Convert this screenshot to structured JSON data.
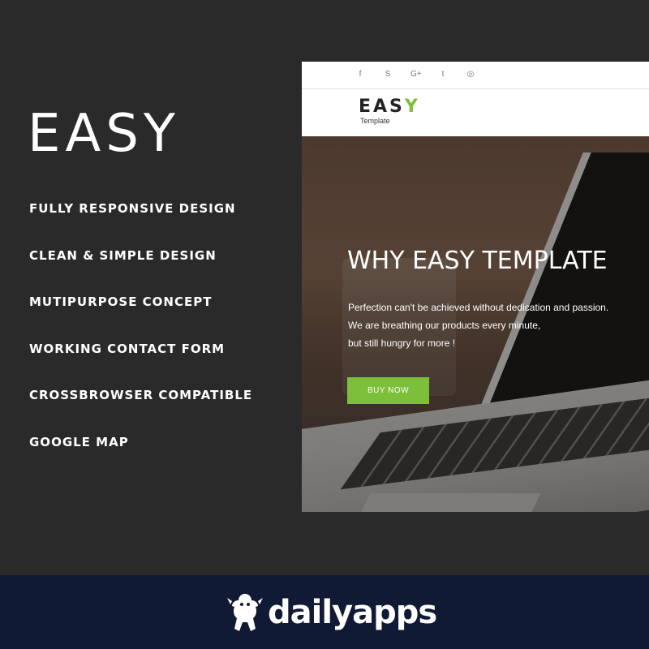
{
  "left": {
    "title": "EASY",
    "features": [
      "FULLY RESPONSIVE DESIGN",
      "CLEAN & SIMPLE DESIGN",
      "MUTIPURPOSE CONCEPT",
      "WORKING CONTACT FORM",
      "CROSSBROWSER COMPATIBLE",
      "GOOGLE MAP"
    ]
  },
  "preview": {
    "social_icons": [
      {
        "name": "facebook-icon",
        "glyph": "f"
      },
      {
        "name": "skype-icon",
        "glyph": "S"
      },
      {
        "name": "google-plus-icon",
        "glyph": "G+"
      },
      {
        "name": "twitter-icon",
        "glyph": "t"
      },
      {
        "name": "dribbble-icon",
        "glyph": "◎"
      }
    ],
    "logo": {
      "word_start": "EAS",
      "word_accent": "Y",
      "subtitle": "Template"
    },
    "hero": {
      "title": "WHY EASY TEMPLATE",
      "lines": [
        "Perfection can't be achieved without dedication and passion.",
        "We are breathing our products every minute,",
        "but still hungry for more !"
      ],
      "button_label": "BUY NOW"
    },
    "accent_color": "#7cbf3a"
  },
  "footer": {
    "brand_name": "dailyapps",
    "background_color": "#101a35"
  }
}
